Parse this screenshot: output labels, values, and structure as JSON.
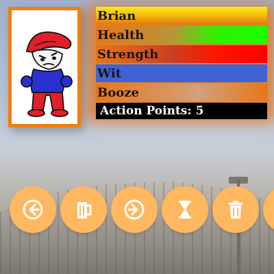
{
  "character": {
    "name": "Brian",
    "stats": [
      {
        "label": "Health",
        "color": "#19ff00"
      },
      {
        "label": "Strength",
        "color": "#ff0000"
      },
      {
        "label": "Wit",
        "color": "#3f63d4"
      },
      {
        "label": "Booze",
        "color": "#e7761a"
      }
    ],
    "action_points_label": "Action Points: 5"
  },
  "actions": [
    {
      "icon": "arrow-left-icon"
    },
    {
      "icon": "beer-mug-icon"
    },
    {
      "icon": "arrow-right-icon"
    },
    {
      "icon": "hourglass-icon"
    },
    {
      "icon": "trash-icon"
    },
    {
      "icon": "more-icon"
    }
  ],
  "colors": {
    "accent": "#f0800d",
    "button": "#ffb85f"
  }
}
